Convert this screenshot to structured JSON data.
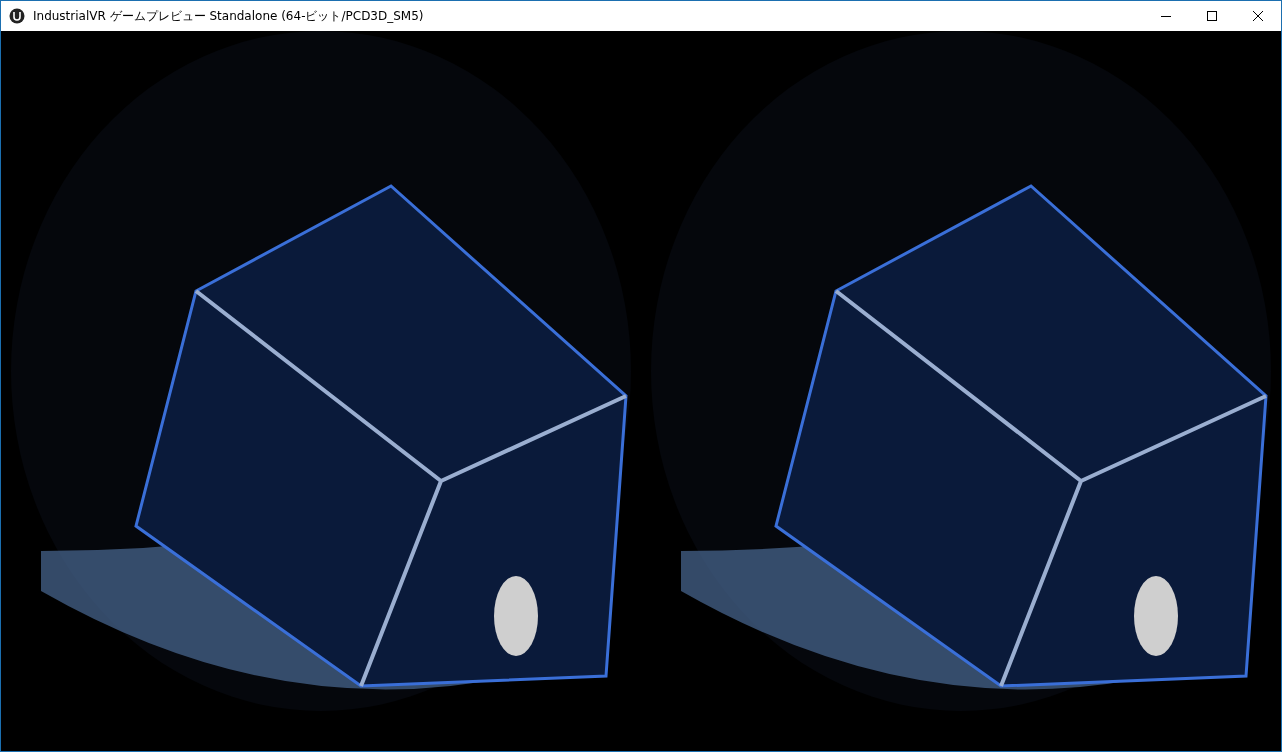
{
  "window": {
    "title": "IndustrialVR ゲームプレビュー Standalone (64-ビット/PCD3D_SM5)"
  }
}
